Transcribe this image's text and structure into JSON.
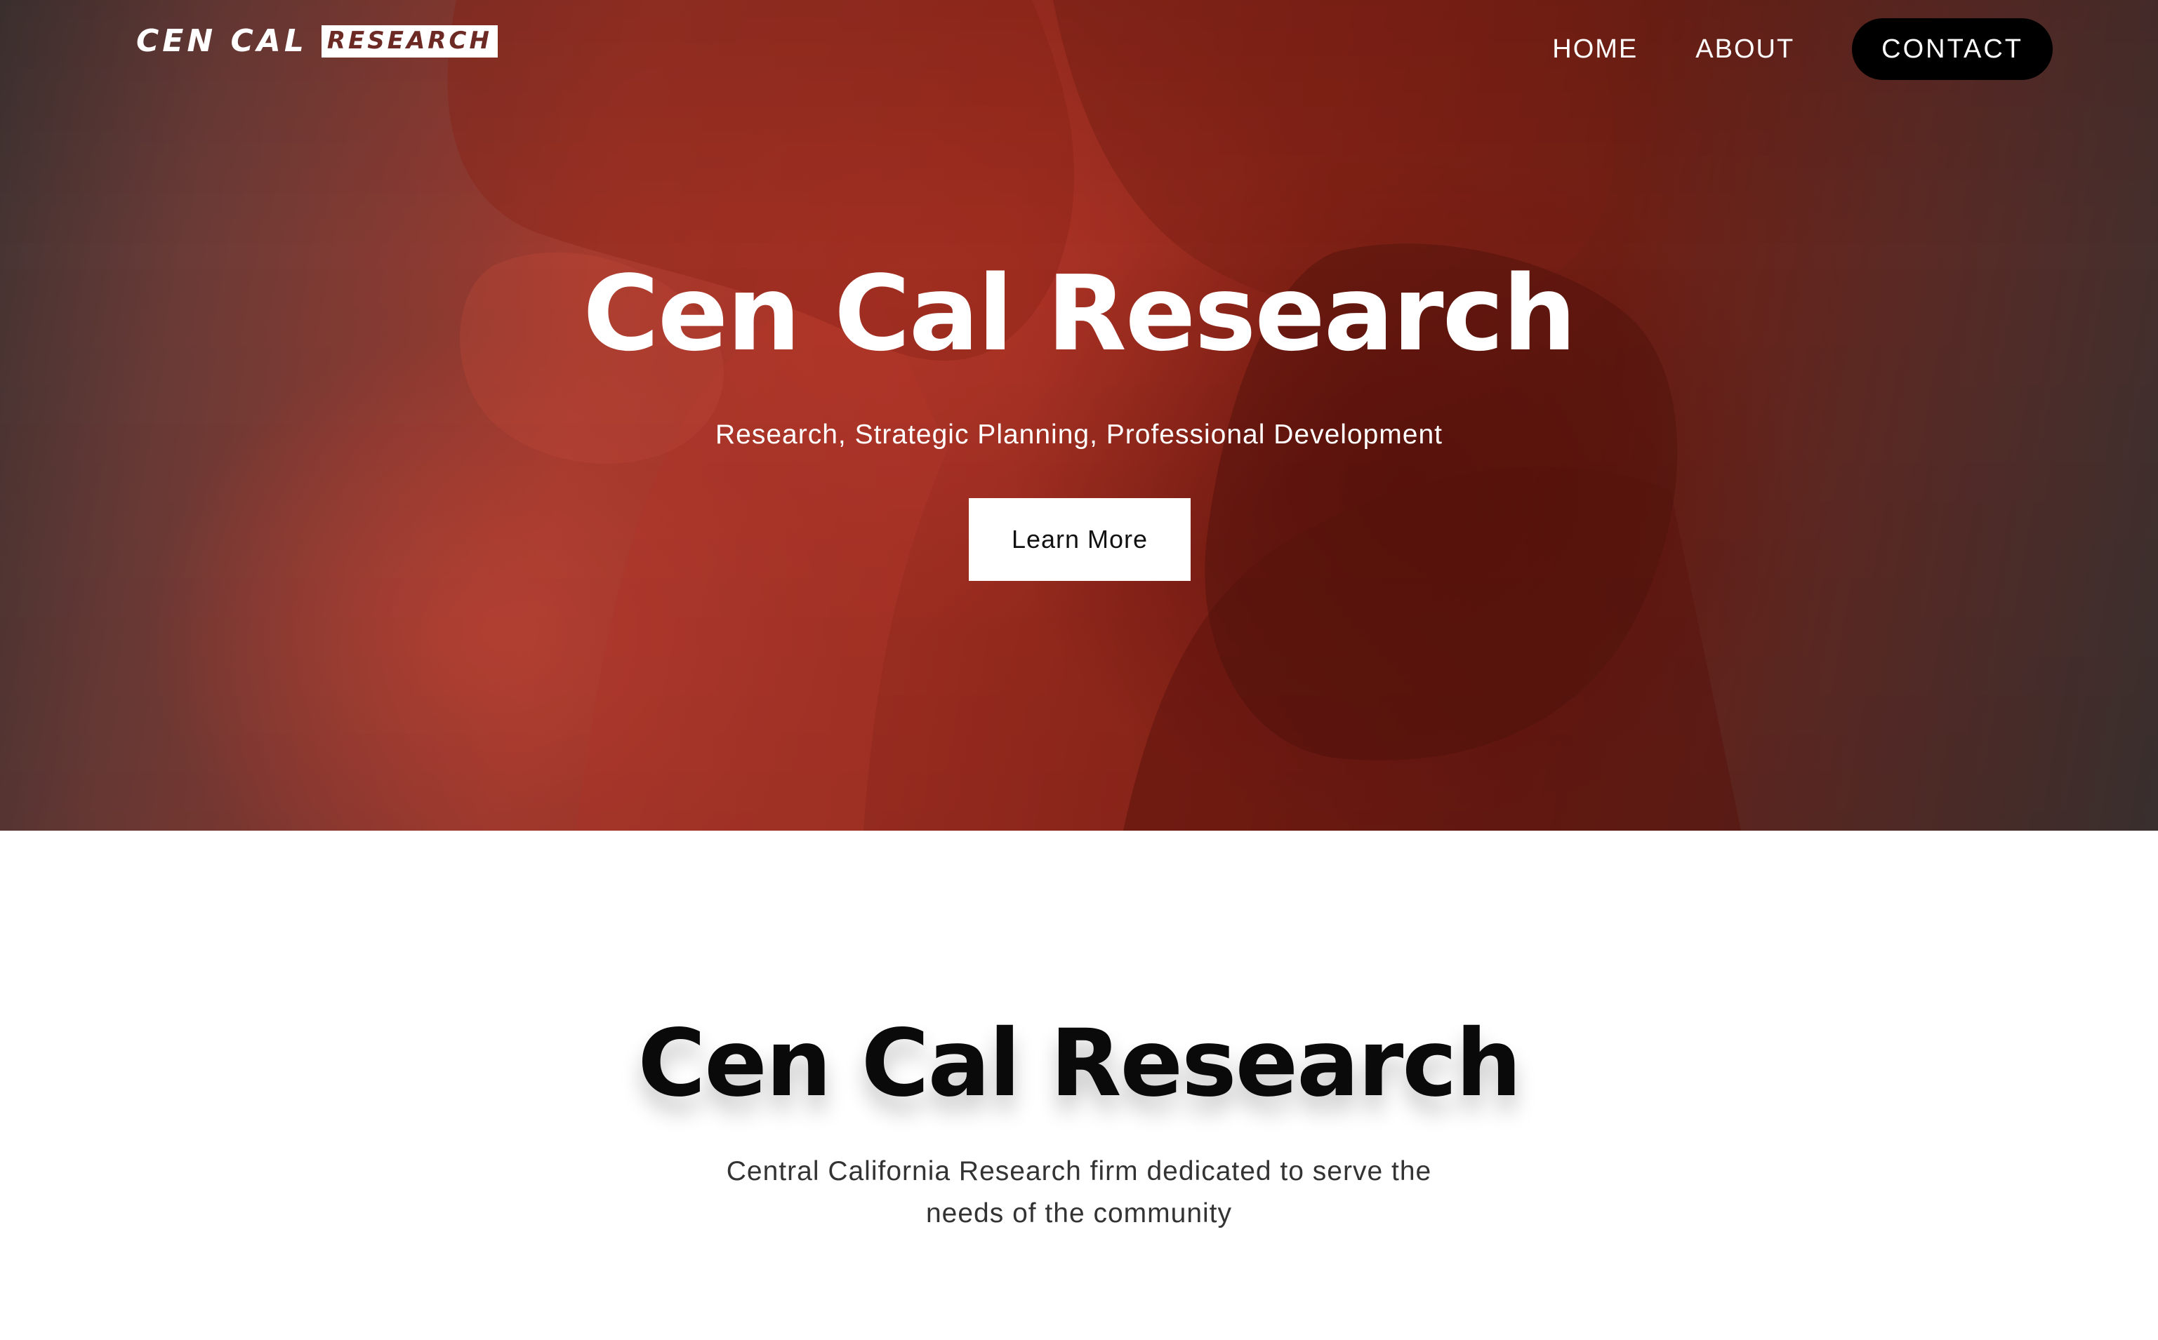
{
  "brand": {
    "logo_word": "CEN CAL",
    "logo_box_word": "RESEARCH"
  },
  "nav": {
    "items": [
      {
        "label": "HOME"
      },
      {
        "label": "ABOUT"
      }
    ],
    "contact_label": "CONTACT"
  },
  "hero": {
    "title": "Cen Cal Research",
    "subtitle": "Research, Strategic Planning, Professional Development",
    "cta_label": "Learn More",
    "image_icon": "hands-clasped-photo"
  },
  "intro": {
    "title": "Cen Cal Research",
    "text": "Central California Research firm dedicated to serve the needs of the community"
  },
  "colors": {
    "hero_overlay": "#9e2d21",
    "contact_button": "#000000",
    "cta_button": "#ffffff",
    "heading_dark": "#0a0a0a"
  }
}
